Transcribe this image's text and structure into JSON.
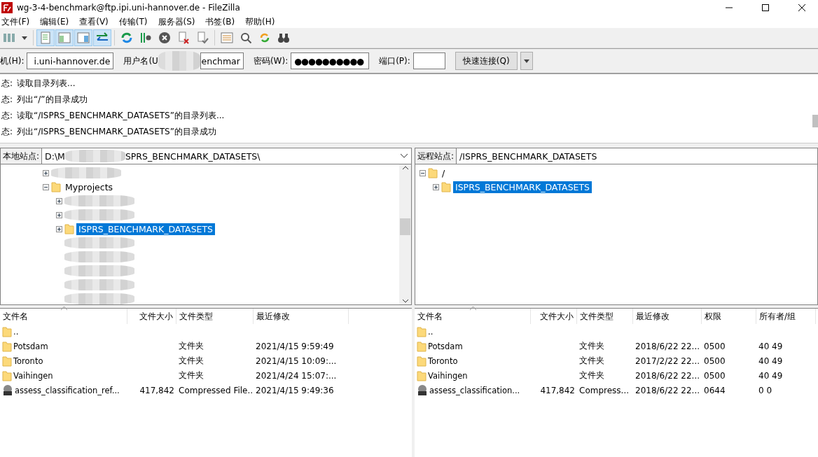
{
  "window": {
    "title": "wg-3-4-benchmark@ftp.ipi.uni-hannover.de - FileZilla"
  },
  "menu": [
    "文件(F)",
    "编辑(E)",
    "查看(V)",
    "传输(T)",
    "服务器(S)",
    "书签(B)",
    "帮助(H)"
  ],
  "toolbar": [
    {
      "kind": "site-manager",
      "pressed": false
    },
    {
      "kind": "dropdown",
      "pressed": false
    },
    {
      "kind": "log",
      "pressed": true
    },
    {
      "kind": "local-tree",
      "pressed": true
    },
    {
      "kind": "remote-tree",
      "pressed": true
    },
    {
      "kind": "queue",
      "pressed": true
    },
    {
      "kind": "refresh",
      "pressed": false
    },
    {
      "kind": "process",
      "pressed": false
    },
    {
      "kind": "cancel",
      "pressed": false
    },
    {
      "kind": "disconnect",
      "pressed": false
    },
    {
      "kind": "reconnect",
      "pressed": false
    },
    {
      "kind": "filter",
      "pressed": false
    },
    {
      "kind": "compare",
      "pressed": false
    },
    {
      "kind": "sync",
      "pressed": false
    },
    {
      "kind": "find",
      "pressed": false
    }
  ],
  "quickconnect": {
    "host_label": "机(H):",
    "host": "i.uni-hannover.de",
    "user_label": "用户名(U",
    "user": "enchmar",
    "password_label": "密码(W):",
    "password": "●●●●●●●●●●",
    "port_label": "端口(P):",
    "button": "快速连接(Q)"
  },
  "log": [
    {
      "label": "态:",
      "message": "读取目录列表..."
    },
    {
      "label": "态:",
      "message": "列出“/”的目录成功"
    },
    {
      "label": "态:",
      "message": "读取“/ISPRS_BENCHMARK_DATASETS”的目录列表..."
    },
    {
      "label": "态:",
      "message": "列出“/ISPRS_BENCHMARK_DATASETS”的目录成功"
    }
  ],
  "local": {
    "site_label": "本地站点:",
    "path_start": "D:\\M",
    "path_end": "SPRS_BENCHMARK_DATASETS\\",
    "tree": [
      {
        "kind": "redacted",
        "expanded": false
      },
      {
        "kind": "folder",
        "label": "Myprojects",
        "expanded": true,
        "children": [
          {
            "kind": "redacted",
            "expanded": false
          },
          {
            "kind": "redacted",
            "expanded": false
          },
          {
            "kind": "folder",
            "label": "ISPRS_BENCHMARK_DATASETS",
            "expanded": false,
            "selected": true
          },
          {
            "kind": "redacted"
          },
          {
            "kind": "redacted"
          },
          {
            "kind": "redacted"
          },
          {
            "kind": "redacted"
          },
          {
            "kind": "redacted"
          }
        ]
      }
    ],
    "columns": [
      "文件名",
      "文件大小",
      "文件类型",
      "最近修改"
    ],
    "rows": [
      {
        "kind": "folder",
        "cells": [
          ".."
        ]
      },
      {
        "kind": "folder",
        "cells": [
          "Potsdam",
          "",
          "文件夹",
          "2021/4/15 9:59:49"
        ]
      },
      {
        "kind": "folder",
        "cells": [
          "Toronto",
          "",
          "文件夹",
          "2021/4/15 10:09:..."
        ]
      },
      {
        "kind": "folder",
        "cells": [
          "Vaihingen",
          "",
          "文件夹",
          "2021/4/24 15:07:..."
        ]
      },
      {
        "kind": "archive",
        "cells": [
          "assess_classification_ref...",
          "417,842",
          "Compressed File...",
          "2021/4/15 9:49:36"
        ]
      }
    ]
  },
  "remote": {
    "site_label": "远程站点:",
    "path": "/ISPRS_BENCHMARK_DATASETS",
    "tree": [
      {
        "kind": "folder",
        "label": "/",
        "expanded": true,
        "selected": false,
        "children": [
          {
            "kind": "folder",
            "label": "ISPRS_BENCHMARK_DATASETS",
            "expanded": false,
            "selected": true
          }
        ]
      }
    ],
    "columns": [
      "文件名",
      "文件大小",
      "文件类型",
      "最近修改",
      "权限",
      "所有者/组"
    ],
    "rows": [
      {
        "kind": "folder",
        "cells": [
          ".."
        ]
      },
      {
        "kind": "folder",
        "cells": [
          "Potsdam",
          "",
          "文件夹",
          "2018/6/22 22...",
          "0500",
          "40 49"
        ]
      },
      {
        "kind": "folder",
        "cells": [
          "Toronto",
          "",
          "文件夹",
          "2017/2/22 22...",
          "0500",
          "40 49"
        ]
      },
      {
        "kind": "folder",
        "cells": [
          "Vaihingen",
          "",
          "文件夹",
          "2018/6/22 22...",
          "0500",
          "40 49"
        ]
      },
      {
        "kind": "archive",
        "cells": [
          "assess_classification...",
          "417,842",
          "Compress...",
          "2018/6/22 22...",
          "0644",
          "0 0"
        ]
      }
    ]
  }
}
